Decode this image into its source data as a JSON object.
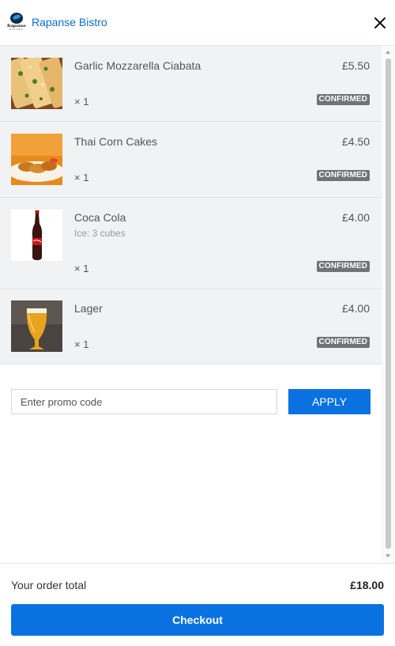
{
  "header": {
    "logo_text": "Rapanse",
    "logo_tagline": "BISTRO",
    "restaurant_name": "Rapanse Bistro",
    "close_icon": "close-icon"
  },
  "items": [
    {
      "name": "Garlic Mozzarella Ciabata",
      "note": "",
      "price": "£5.50",
      "qty": "× 1",
      "status": "CONFIRMED",
      "image": "ciabatta-image"
    },
    {
      "name": "Thai Corn Cakes",
      "note": "",
      "price": "£4.50",
      "qty": "× 1",
      "status": "CONFIRMED",
      "image": "corn-cakes-image"
    },
    {
      "name": "Coca Cola",
      "note": "Ice: 3 cubes",
      "price": "£4.00",
      "qty": "× 1",
      "status": "CONFIRMED",
      "image": "coca-cola-bottle-image"
    },
    {
      "name": "Lager",
      "note": "",
      "price": "£4.00",
      "qty": "× 1",
      "status": "CONFIRMED",
      "image": "lager-glass-image"
    }
  ],
  "promo": {
    "placeholder": "Enter promo code",
    "value": "",
    "apply_label": "APPLY"
  },
  "footer": {
    "total_label": "Your order total",
    "total_value": "£18.00",
    "checkout_label": "Checkout"
  },
  "colors": {
    "accent": "#0a72e0",
    "link": "#0a6fd1",
    "badge": "#6f7477",
    "row_bg": "#f0f2f4"
  }
}
